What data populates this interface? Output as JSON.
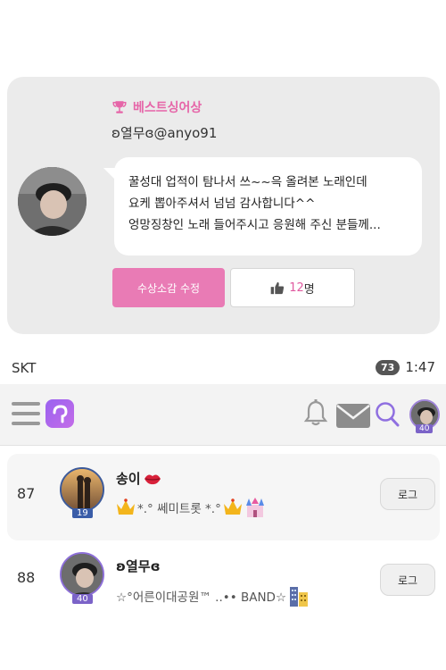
{
  "award": {
    "title": "베스트싱어상",
    "user": "ʚ열무ɞ@anyo91",
    "message_lines": [
      "꿀성대 업적이 탐나서 쓰~~윽 올려본 노래인데",
      "요케 뽑아주셔서 넘넘 감사합니다^^",
      "엉망징창인 노래 들어주시고 응원해 주신 분들께..."
    ],
    "edit_label": "수상소감 수정",
    "like_count": "12",
    "like_unit": "명"
  },
  "status": {
    "carrier": "SKT",
    "battery": "73",
    "time": "1:47"
  },
  "header": {
    "avatar_level": "40"
  },
  "ranking": [
    {
      "rank": "87",
      "name": "송이",
      "level": "19",
      "bio": "*.° 쎄미트롯 *.°",
      "log_label": "로그"
    },
    {
      "rank": "88",
      "name": "ʚ열무ɞ",
      "level": "40",
      "bio": "☆°어른이대공원™ ..•• BAND☆",
      "log_label": "로그"
    }
  ],
  "colors": {
    "accent_pink": "#e97bb5",
    "title_pink": "#e665a8",
    "level_purple": "#7b63c8",
    "level_blue": "#3a5da8"
  },
  "icons": [
    "trophy-icon",
    "thumbs-up-icon",
    "menu-icon",
    "app-logo-icon",
    "bell-icon",
    "mail-icon",
    "search-icon",
    "lips-icon",
    "crown-icon",
    "castle-icon",
    "building-icon"
  ]
}
